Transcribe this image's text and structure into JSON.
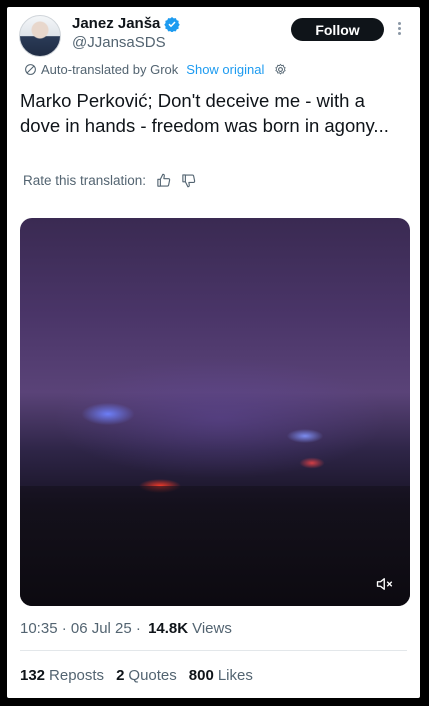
{
  "author": {
    "name": "Janez Janša",
    "handle": "@JJansaSDS",
    "follow_label": "Follow"
  },
  "translation": {
    "notice": "Auto-translated by Grok",
    "show_original": "Show original",
    "rate_label": "Rate this translation:"
  },
  "tweet": {
    "text": "Marko Perković; Don't deceive me - with a dove in hands - freedom was born in agony..."
  },
  "meta": {
    "timestamp": "10:35 · 06 Jul 25 · ",
    "views_count": "14.8K",
    "views_label": "Views"
  },
  "stats": {
    "reposts_count": "132",
    "reposts_label": "Reposts",
    "quotes_count": "2",
    "quotes_label": "Quotes",
    "likes_count": "800",
    "likes_label": "Likes"
  },
  "colors": {
    "accent": "#1d9bf0",
    "text": "#0f1419",
    "muted": "#536471"
  }
}
